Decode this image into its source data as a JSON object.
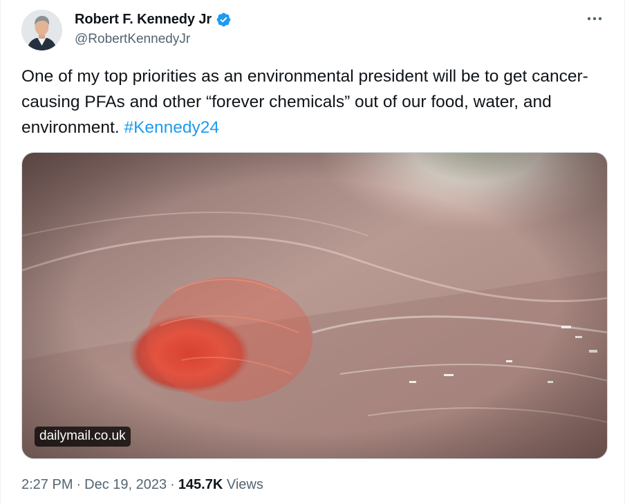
{
  "author": {
    "display_name": "Robert F. Kennedy Jr",
    "handle": "@RobertKennedyJr",
    "verified": true,
    "avatar_icon": "profile-photo",
    "verified_icon": "verified-badge-icon"
  },
  "more_icon": "more-options-icon",
  "tweet": {
    "text": "One of my top priorities as an environmental president will be to get cancer-causing PFAs and other “forever chemicals” out of our food, water, and environment. ",
    "hashtag": "#Kennedy24"
  },
  "media": {
    "link_label": "dailymail.co.uk"
  },
  "meta": {
    "time": "2:27 PM",
    "separator": "·",
    "date": "Dec 19, 2023",
    "views_count": "145.7K",
    "views_label": "Views"
  },
  "colors": {
    "accent": "#1d9bf0",
    "text": "#0f1419",
    "secondary": "#536471"
  }
}
